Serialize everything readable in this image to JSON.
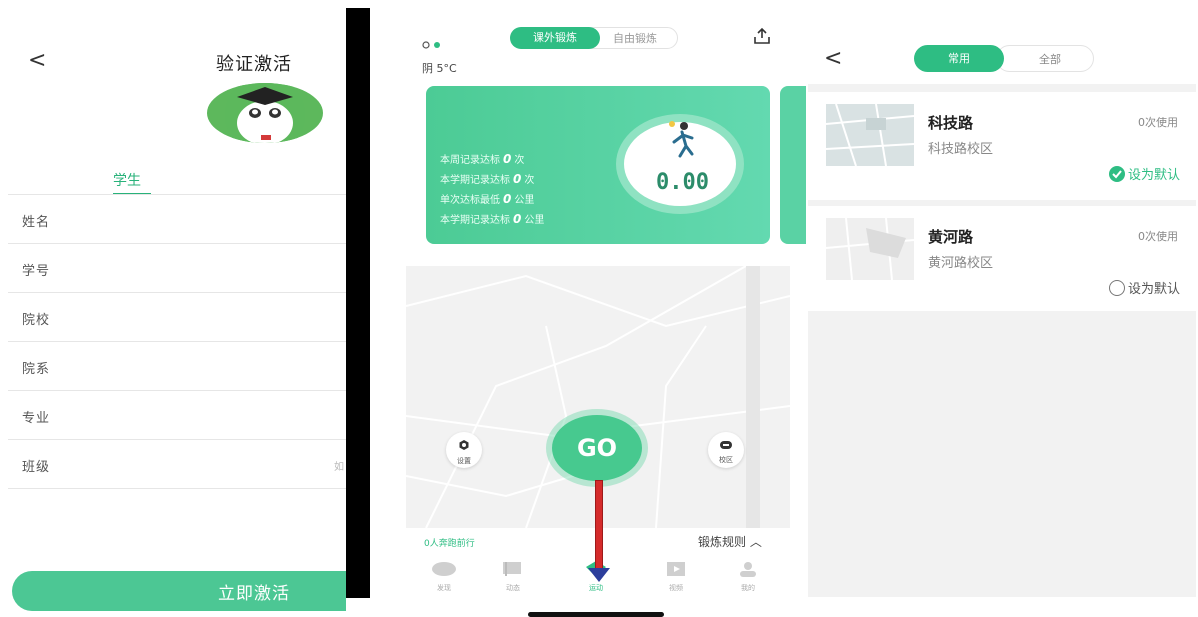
{
  "panel1": {
    "back_label": "<",
    "title": "验证激活",
    "tab": "学生",
    "fields": [
      {
        "label": "姓名",
        "placeholder": ""
      },
      {
        "label": "学号",
        "placeholder": ""
      },
      {
        "label": "院校",
        "placeholder": ""
      },
      {
        "label": "院系",
        "placeholder": ""
      },
      {
        "label": "专业",
        "placeholder": ""
      },
      {
        "label": "班级",
        "placeholder": "如"
      }
    ],
    "activate_label": "立即激活"
  },
  "panel2": {
    "tabs": [
      "课外锻炼",
      "自由锻炼"
    ],
    "weather": "阴 5°C",
    "stats": {
      "week_label_pre": "本周记录达标",
      "week_value": "0",
      "week_unit": "次",
      "term_label_pre": "本学期记录达标",
      "term_value": "0",
      "term_unit": "次",
      "single_label_pre": "单次达标最低",
      "single_value": "0",
      "single_unit": "公里",
      "term_dist_label_pre": "本学期记录达标",
      "term_dist_value": "0",
      "term_dist_unit": "公里"
    },
    "distance": "0.00",
    "settings_label": "设置",
    "campus_label": "校区",
    "go_label": "GO",
    "runners_text": "0人奔跑前行",
    "rules_text": "锻炼规则 ︿",
    "nav": [
      {
        "label": "发现",
        "icon": "discover-icon"
      },
      {
        "label": "动态",
        "icon": "moments-icon"
      },
      {
        "label": "运动",
        "icon": "sport-icon"
      },
      {
        "label": "视频",
        "icon": "video-icon"
      },
      {
        "label": "我的",
        "icon": "profile-icon"
      }
    ],
    "accent": "#2ebd83"
  },
  "panel3": {
    "back_label": "<",
    "tabs": [
      "常用",
      "全部"
    ],
    "campuses": [
      {
        "name": "科技路",
        "sub": "科技路校区",
        "usage": "0次使用",
        "default_label": "设为默认",
        "is_default": true
      },
      {
        "name": "黄河路",
        "sub": "黄河路校区",
        "usage": "0次使用",
        "default_label": "设为默认",
        "is_default": false
      }
    ]
  }
}
